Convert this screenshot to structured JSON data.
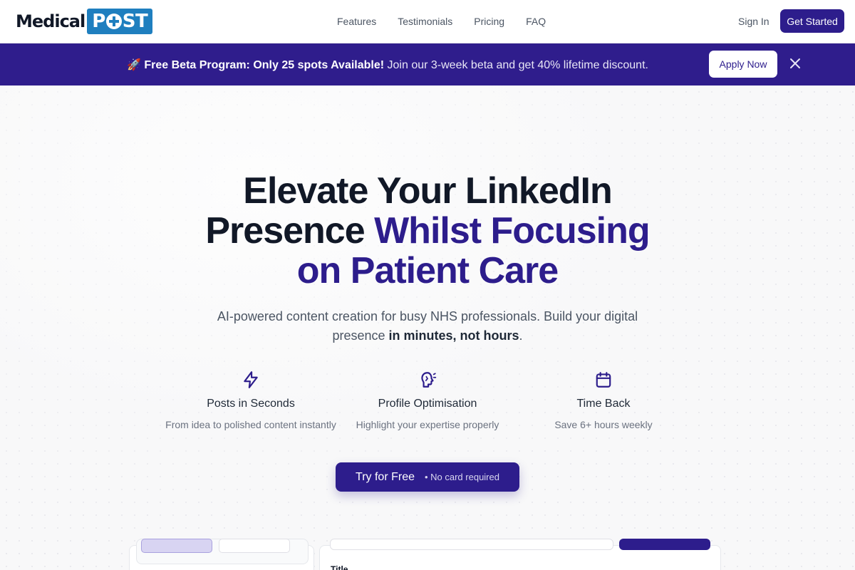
{
  "header": {
    "logo": {
      "word1": "Medical",
      "word2a": "P",
      "word2b": "ST"
    },
    "nav": [
      "Features",
      "Testimonials",
      "Pricing",
      "FAQ"
    ],
    "signin": "Sign In",
    "get_started": "Get Started"
  },
  "banner": {
    "emoji": "🚀",
    "bold": "Free Beta Program: Only 25 spots Available!",
    "text": " Join our 3-week beta and get 40% lifetime discount.",
    "apply": "Apply Now"
  },
  "hero": {
    "headline_line1": "Elevate Your LinkedIn",
    "headline_line2a": "Presence ",
    "headline_line2b": "Whilst Focusing",
    "headline_line3": "on Patient Care",
    "sub_a": "AI-powered content creation for busy NHS professionals. Build your digital presence ",
    "sub_b": "in minutes, not hours",
    "sub_c": "."
  },
  "features": [
    {
      "icon": "lightning-icon",
      "title": "Posts in Seconds",
      "desc": "From idea to polished content instantly"
    },
    {
      "icon": "profile-head-icon",
      "title": "Profile Optimisation",
      "desc": "Highlight your expertise properly"
    },
    {
      "icon": "calendar-icon",
      "title": "Time Back",
      "desc": "Save 6+ hours weekly"
    }
  ],
  "cta": {
    "label": "Try for Free",
    "note": "• No card required"
  },
  "preview": {
    "title_label": "Title"
  },
  "colors": {
    "brand": "#2d1d8c",
    "logo_blue": "#1f7fbf"
  }
}
